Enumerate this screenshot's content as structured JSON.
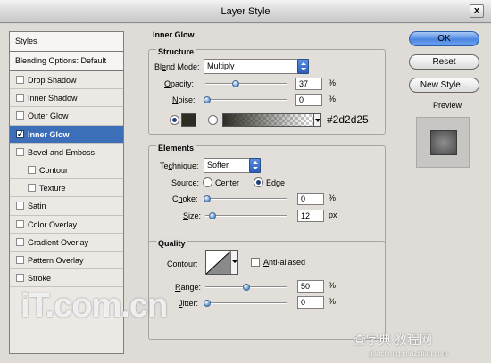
{
  "window": {
    "title": "Layer Style",
    "close_label": "x"
  },
  "style_list": {
    "header": "Styles",
    "blending_options": "Blending Options: Default",
    "items": [
      {
        "label": "Drop Shadow",
        "checked": false
      },
      {
        "label": "Inner Shadow",
        "checked": false
      },
      {
        "label": "Outer Glow",
        "checked": false
      },
      {
        "label": "Inner Glow",
        "checked": true,
        "selected": true
      },
      {
        "label": "Bevel and Emboss",
        "checked": false
      },
      {
        "label": "Contour",
        "checked": false,
        "sub": true
      },
      {
        "label": "Texture",
        "checked": false,
        "sub": true
      },
      {
        "label": "Satin",
        "checked": false
      },
      {
        "label": "Color Overlay",
        "checked": false
      },
      {
        "label": "Gradient Overlay",
        "checked": false
      },
      {
        "label": "Pattern Overlay",
        "checked": false
      },
      {
        "label": "Stroke",
        "checked": false
      }
    ]
  },
  "panel": {
    "title": "Inner Glow",
    "structure": {
      "legend": "Structure",
      "blend_mode_label": "Blend Mode:",
      "blend_mode_value": "Multiply",
      "opacity_label": "Opacity:",
      "opacity_value": "37",
      "opacity_unit": "%",
      "noise_label": "Noise:",
      "noise_value": "0",
      "noise_unit": "%",
      "color_hex": "#2d2d25",
      "color_selected": "solid"
    },
    "elements": {
      "legend": "Elements",
      "technique_label": "Technique:",
      "technique_value": "Softer",
      "source_label": "Source:",
      "source_center": "Center",
      "source_edge": "Edge",
      "source_selected": "edge",
      "choke_label": "Choke:",
      "choke_value": "0",
      "choke_unit": "%",
      "size_label": "Size:",
      "size_value": "12",
      "size_unit": "px"
    },
    "quality": {
      "legend": "Quality",
      "contour_label": "Contour:",
      "anti_aliased_label": "Anti-aliased",
      "anti_aliased_checked": false,
      "range_label": "Range:",
      "range_value": "50",
      "range_unit": "%",
      "jitter_label": "Jitter:",
      "jitter_value": "0",
      "jitter_unit": "%"
    }
  },
  "buttons": {
    "ok": "OK",
    "reset": "Reset",
    "new_style": "New Style...",
    "preview_label": "Preview",
    "preview_checked": true
  },
  "watermarks": {
    "logo": "iT.com.cn",
    "site": "查字典 教程网",
    "url": "jiaocheng.chazidian.com"
  },
  "colors": {
    "glow_color": "#2d2d25",
    "selected_row": "#3c6fb8",
    "accent_button": "#4b86e2"
  }
}
